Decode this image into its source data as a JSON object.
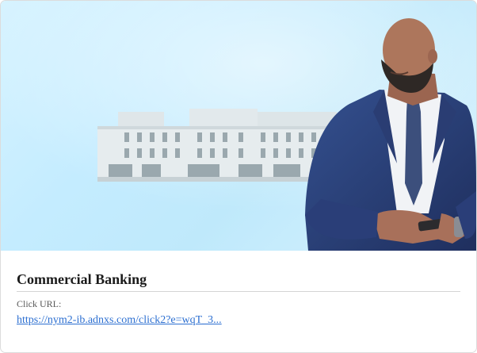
{
  "card": {
    "title": "Commercial Banking",
    "click_url_label": "Click URL:",
    "click_url": "https://nym2-ib.adnxs.com/click2?e=wqT_3..."
  },
  "hero": {
    "image_name": "businessman-building-banner",
    "colors": {
      "sky": "#c4ecff",
      "suit": "#2a3f78",
      "shirt": "#f3f4f6",
      "tie": "#3a4f7e",
      "skin": "#a9735a",
      "building": "#e8eef0"
    }
  }
}
